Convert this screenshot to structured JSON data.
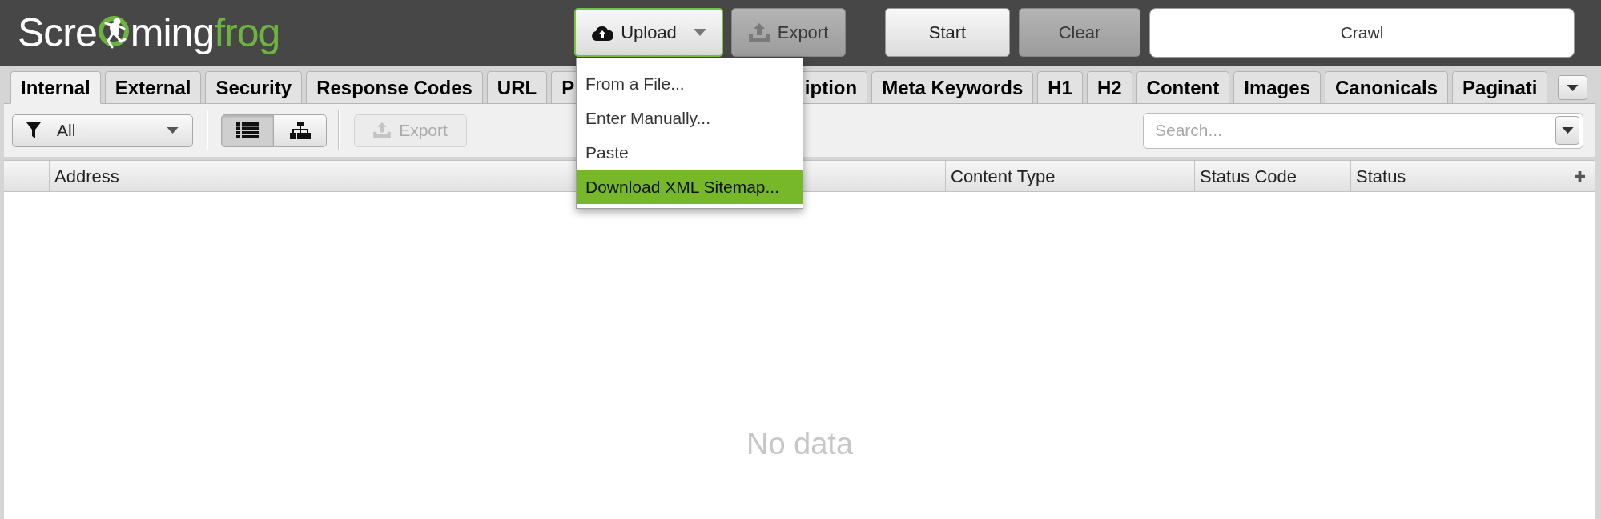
{
  "header": {
    "logo": {
      "start": "Scre",
      "middle": "ming",
      "end": "frog"
    },
    "upload_button": {
      "label": "Upload",
      "expanded": true,
      "menu": [
        {
          "label": "From a File...",
          "selected": false
        },
        {
          "label": "Enter Manually...",
          "selected": false
        },
        {
          "label": "Paste",
          "selected": false
        },
        {
          "label": "Download XML Sitemap...",
          "selected": true
        }
      ]
    },
    "export_button": {
      "label": "Export",
      "disabled": true
    },
    "start_button": {
      "label": "Start",
      "disabled": false
    },
    "clear_button": {
      "label": "Clear",
      "disabled": true
    },
    "crawl_display": {
      "label": "Crawl"
    }
  },
  "tabs": [
    {
      "label": "Internal",
      "selected": true
    },
    {
      "label": "External",
      "selected": false
    },
    {
      "label": "Security",
      "selected": false
    },
    {
      "label": "Response Codes",
      "selected": false
    },
    {
      "label": "URL",
      "selected": false
    },
    {
      "label": "P",
      "selected": false
    },
    {
      "label": "iption",
      "selected": false
    },
    {
      "label": "Meta Keywords",
      "selected": false
    },
    {
      "label": "H1",
      "selected": false
    },
    {
      "label": "H2",
      "selected": false
    },
    {
      "label": "Content",
      "selected": false
    },
    {
      "label": "Images",
      "selected": false
    },
    {
      "label": "Canonicals",
      "selected": false
    },
    {
      "label": "Paginati",
      "selected": false
    }
  ],
  "toolbar": {
    "filter": {
      "value": "All"
    },
    "view_buttons": [
      {
        "kind": "list",
        "selected": true
      },
      {
        "kind": "tree",
        "selected": false
      }
    ],
    "export_button": {
      "label": "Export",
      "disabled": true
    },
    "search": {
      "placeholder": "Search..."
    }
  },
  "table": {
    "columns": [
      "Address",
      "Content Type",
      "Status Code",
      "Status"
    ],
    "empty_message": "No data"
  }
}
